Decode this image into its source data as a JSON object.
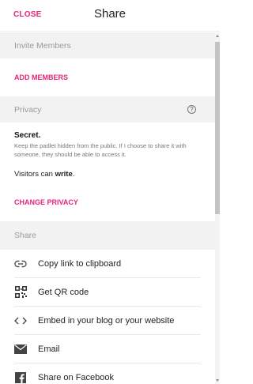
{
  "header": {
    "close_label": "CLOSE",
    "title": "Share"
  },
  "invite": {
    "heading": "Invite Members",
    "add_members": "ADD MEMBERS"
  },
  "privacy": {
    "heading": "Privacy",
    "help_icon": "?",
    "title": "Secret",
    "description": "Keep the padlet hidden from the public. If I choose to share it with someone, they should be able to access it.",
    "visitors_prefix": "Visitors can ",
    "visitors_permission": "write",
    "change": "CHANGE PRIVACY"
  },
  "share": {
    "heading": "Share",
    "items": [
      {
        "label": "Copy link to clipboard",
        "icon": "link-icon"
      },
      {
        "label": "Get QR code",
        "icon": "qr-code-icon"
      },
      {
        "label": "Embed in your blog or your website",
        "icon": "code-embed-icon"
      },
      {
        "label": "Email",
        "icon": "email-icon"
      },
      {
        "label": "Share on Facebook",
        "icon": "facebook-icon"
      }
    ]
  },
  "colors": {
    "accent": "#e8247b",
    "section_bg": "#f2f2f2"
  }
}
